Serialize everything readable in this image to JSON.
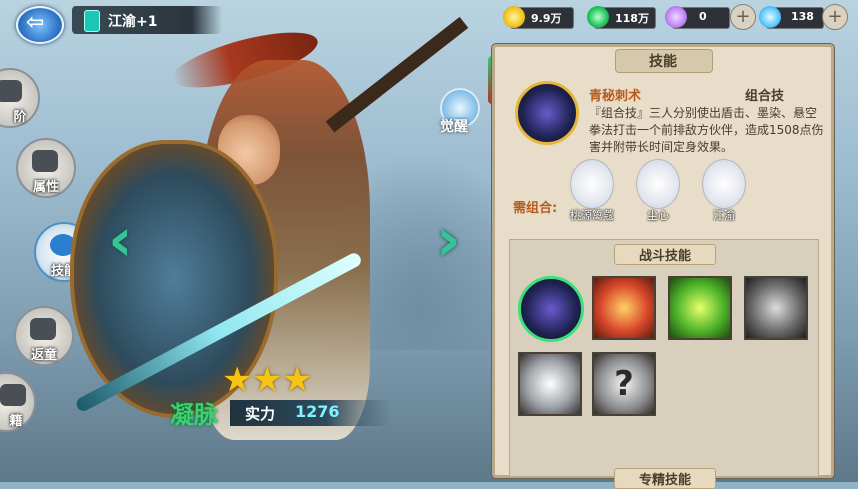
{
  "header": {
    "back_icon": "back-arrow-icon",
    "hero_tag_text": "江渝+1",
    "resources": [
      {
        "icon": "gold-coin-icon",
        "color": "#f2c21a",
        "value": "9.9万"
      },
      {
        "icon": "jade-icon",
        "color": "#22c25a",
        "value": "118万"
      },
      {
        "icon": "purple-orb-icon",
        "color": "#c084f5",
        "value": "0"
      },
      {
        "icon": "diamond-icon",
        "color": "#57c7ff",
        "value": "138"
      }
    ]
  },
  "sidebar": {
    "items": [
      {
        "label": "阶",
        "icon": "rank-icon"
      },
      {
        "label": "属性",
        "icon": "attributes-icon"
      },
      {
        "label": "技能",
        "icon": "skill-icon",
        "active": true
      },
      {
        "label": "返童",
        "icon": "rebirth-icon"
      },
      {
        "label": "籍",
        "icon": "book-icon"
      }
    ]
  },
  "hero": {
    "awaken_label": "觉醒",
    "stars": 3,
    "rank_badge": "凝脉",
    "power_label": "实力",
    "power_value": "1276"
  },
  "panel": {
    "title": "技能",
    "skill": {
      "name": "青秘刺术",
      "type": "组合技",
      "description": "『组合技』三人分别使出盾击、墨染、悬空拳法打击一个前排敌方伙伴，造成1508点伤害并附带长时间定身效果。"
    },
    "combo": {
      "label": "需组合:",
      "heroes": [
        "桃源篱蔻",
        "尘心",
        "江渝"
      ]
    },
    "battle_section_title": "战斗技能",
    "battle_skills": [
      {
        "icon": "combo-skill-icon",
        "selected": true
      },
      {
        "icon": "shield-bash-icon"
      },
      {
        "icon": "green-warrior-icon"
      },
      {
        "icon": "dark-armor-icon"
      },
      {
        "icon": "silver-shield-icon"
      },
      {
        "icon": "question-mark-icon",
        "glyph": "?"
      }
    ],
    "next_section_title": "专精技能"
  },
  "colors": {
    "accent_green": "#38c29a",
    "panel_bg": "#e7ddc8",
    "skill_name": "#b85b1e",
    "power_value": "#7ff3ff"
  }
}
